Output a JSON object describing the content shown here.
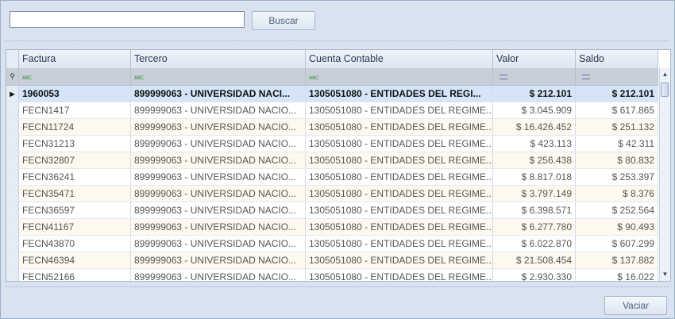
{
  "search": {
    "value": "",
    "button_label": "Buscar"
  },
  "grid": {
    "columns": [
      "Factura",
      "Tercero",
      "Cuenta Contable",
      "Valor",
      "Saldo"
    ],
    "filter_icons": [
      "abc-icon",
      "abc-icon",
      "abc-icon",
      "equals-icon",
      "equals-icon"
    ],
    "rows": [
      {
        "factura": "1960053",
        "tercero": "899999063 - UNIVERSIDAD NACI...",
        "cuenta": "1305051080 - ENTIDADES DEL REGI...",
        "valor": "$ 212.101",
        "saldo": "$ 212.101",
        "selected": true
      },
      {
        "factura": "FECN1417",
        "tercero": "899999063 - UNIVERSIDAD NACIO...",
        "cuenta": "1305051080 - ENTIDADES DEL REGIME...",
        "valor": "$ 3.045.909",
        "saldo": "$ 617.865"
      },
      {
        "factura": "FECN11724",
        "tercero": "899999063 - UNIVERSIDAD NACIO...",
        "cuenta": "1305051080 - ENTIDADES DEL REGIME...",
        "valor": "$ 16.426.452",
        "saldo": "$ 251.132"
      },
      {
        "factura": "FECN31213",
        "tercero": "899999063 - UNIVERSIDAD NACIO...",
        "cuenta": "1305051080 - ENTIDADES DEL REGIME...",
        "valor": "$ 423.113",
        "saldo": "$ 42.311"
      },
      {
        "factura": "FECN32807",
        "tercero": "899999063 - UNIVERSIDAD NACIO...",
        "cuenta": "1305051080 - ENTIDADES DEL REGIME...",
        "valor": "$ 256.438",
        "saldo": "$ 80.832"
      },
      {
        "factura": "FECN36241",
        "tercero": "899999063 - UNIVERSIDAD NACIO...",
        "cuenta": "1305051080 - ENTIDADES DEL REGIME...",
        "valor": "$ 8.817.018",
        "saldo": "$ 253.397"
      },
      {
        "factura": "FECN35471",
        "tercero": "899999063 - UNIVERSIDAD NACIO...",
        "cuenta": "1305051080 - ENTIDADES DEL REGIME...",
        "valor": "$ 3.797.149",
        "saldo": "$ 8.376"
      },
      {
        "factura": "FECN36597",
        "tercero": "899999063 - UNIVERSIDAD NACIO...",
        "cuenta": "1305051080 - ENTIDADES DEL REGIME...",
        "valor": "$ 6.398.571",
        "saldo": "$ 252.564"
      },
      {
        "factura": "FECN41167",
        "tercero": "899999063 - UNIVERSIDAD NACIO...",
        "cuenta": "1305051080 - ENTIDADES DEL REGIME...",
        "valor": "$ 6.277.780",
        "saldo": "$ 90.493"
      },
      {
        "factura": "FECN43870",
        "tercero": "899999063 - UNIVERSIDAD NACIO...",
        "cuenta": "1305051080 - ENTIDADES DEL REGIME...",
        "valor": "$ 6.022.870",
        "saldo": "$ 607.299"
      },
      {
        "factura": "FECN46394",
        "tercero": "899999063 - UNIVERSIDAD NACIO...",
        "cuenta": "1305051080 - ENTIDADES DEL REGIME...",
        "valor": "$ 21.508.454",
        "saldo": "$ 137.882"
      },
      {
        "factura": "FECN52166",
        "tercero": "899999063 - UNIVERSIDAD NACIO...",
        "cuenta": "1305051080 - ENTIDADES DEL REGIME...",
        "valor": "$ 2.930.330",
        "saldo": "$ 16.022"
      }
    ]
  },
  "footer": {
    "clear_label": "Vaciar"
  }
}
